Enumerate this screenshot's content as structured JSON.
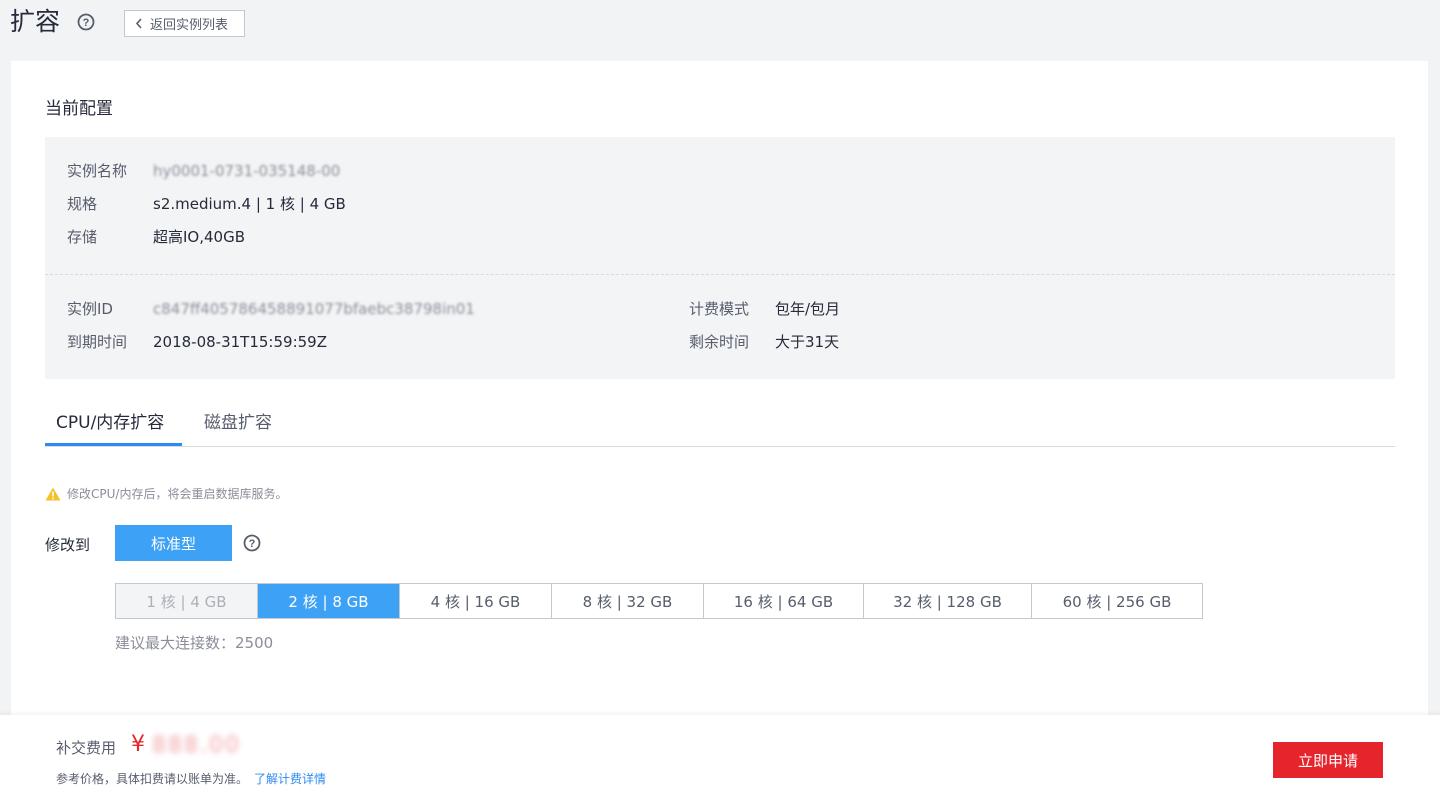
{
  "header": {
    "title": "扩容",
    "back_label": "返回实例列表"
  },
  "current_config": {
    "section_title": "当前配置",
    "instance_name_label": "实例名称",
    "instance_name_value": "hy0001-0731-035148-00",
    "spec_label": "规格",
    "spec_value": "s2.medium.4 | 1 核 | 4 GB",
    "storage_label": "存储",
    "storage_value": "超高IO,40GB",
    "instance_id_label": "实例ID",
    "instance_id_value": "c847ff405786458891077bfaebc38798in01",
    "expire_label": "到期时间",
    "expire_value": "2018-08-31T15:59:59Z",
    "billing_label": "计费模式",
    "billing_value": "包年/包月",
    "remaining_label": "剩余时间",
    "remaining_value": "大于31天"
  },
  "tabs": [
    {
      "label": "CPU/内存扩容",
      "active": true
    },
    {
      "label": "磁盘扩容",
      "active": false
    }
  ],
  "warning": "修改CPU/内存后，将会重启数据库服务。",
  "modify": {
    "label": "修改到",
    "type_button": "标准型"
  },
  "specs": [
    {
      "label": "1 核 | 4 GB",
      "state": "disabled"
    },
    {
      "label": "2 核 | 8 GB",
      "state": "selected"
    },
    {
      "label": "4 核 | 16 GB",
      "state": "normal"
    },
    {
      "label": "8 核 | 32 GB",
      "state": "normal"
    },
    {
      "label": "16 核 | 64 GB",
      "state": "normal"
    },
    {
      "label": "32 核 | 128 GB",
      "state": "normal"
    },
    {
      "label": "60 核 | 256 GB",
      "state": "normal"
    }
  ],
  "connection_hint": "建议最大连接数：2500",
  "footer": {
    "fee_label": "补交费用",
    "currency": "¥",
    "amount": "888.00",
    "note": "参考价格，具体扣费请以账单为准。",
    "link": "了解计费详情",
    "apply_button": "立即申请"
  },
  "colors": {
    "accent": "#3da1f5",
    "danger": "#e5252b",
    "warning": "#f5c126"
  }
}
